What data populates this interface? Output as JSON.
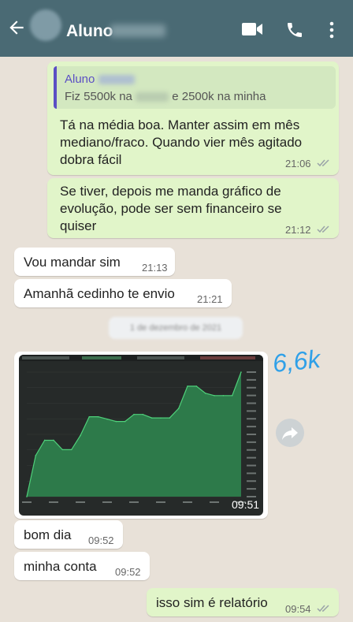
{
  "header": {
    "contact_name": "Aluno",
    "back_icon": "arrow-left-icon",
    "video_icon": "video-camera-icon",
    "call_icon": "phone-icon",
    "menu_icon": "more-vertical-icon"
  },
  "messages": {
    "m1": {
      "quote_author": "Aluno",
      "quote_text_a": "Fiz 5500k na",
      "quote_text_b": "e 2500k na minha",
      "line1": "Tá na média boa. Manter assim em mês",
      "line2": "mediano/fraco. Quando vier mês agitado",
      "line3": "dobra fácil",
      "time": "21:06"
    },
    "m2": {
      "line1": "Se tiver, depois me manda gráfico de",
      "line2": "evolução, pode ser sem financeiro se",
      "line3": "quiser",
      "time": "21:12"
    },
    "m3": {
      "text": "Vou mandar sim",
      "time": "21:13"
    },
    "m4": {
      "text": "Amanhã cedinho te envio",
      "time": "21:21"
    },
    "date_chip": "1 de dezembro de 2021",
    "m5": {
      "time": "09:51",
      "annotation": "6,6k"
    },
    "m6": {
      "text": "bom dia",
      "time": "09:52"
    },
    "m7": {
      "text": "minha conta",
      "time": "09:52"
    },
    "m8": {
      "text": "isso sim é relatório",
      "time": "09:54"
    }
  },
  "colors": {
    "header_bg": "#4a6a74",
    "outgoing_bubble": "#e1f5c9",
    "incoming_bubble": "#ffffff",
    "read_ticks": "#9aa3a8",
    "chart_fill": "#2d7a4a",
    "annotation": "#2fa0e8"
  },
  "chart_data": {
    "type": "area",
    "values": [
      0,
      0.35,
      0.48,
      0.48,
      0.4,
      0.4,
      0.52,
      0.68,
      0.68,
      0.66,
      0.64,
      0.64,
      0.7,
      0.7,
      0.67,
      0.67,
      0.67,
      0.75,
      0.94,
      0.94,
      0.88,
      0.86,
      0.86,
      0.86,
      1.06
    ],
    "note": "cumulative evolution curve (values normalized, financial amounts hidden)"
  }
}
